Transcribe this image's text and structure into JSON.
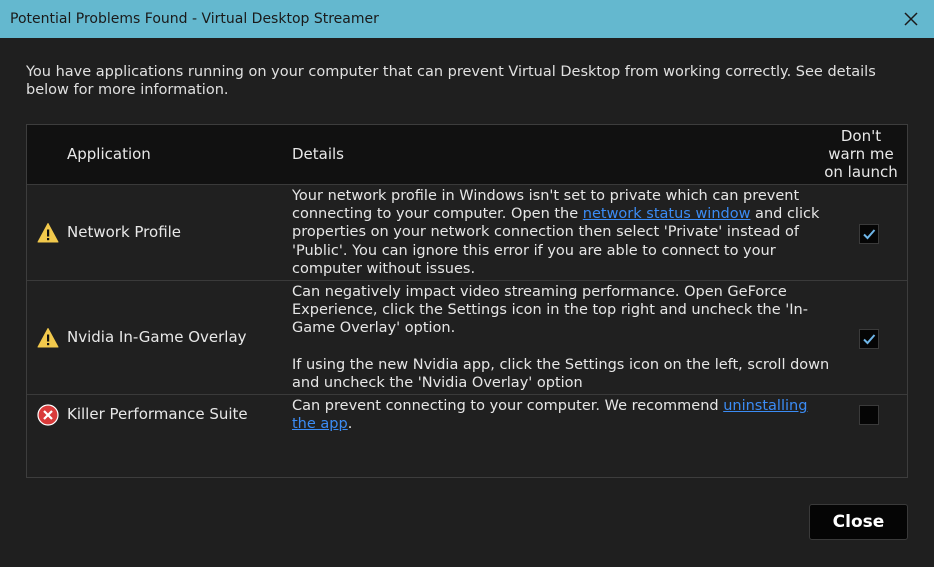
{
  "window": {
    "title": "Potential Problems Found - Virtual Desktop Streamer"
  },
  "intro": "You have applications running on your computer that can prevent Virtual Desktop from working correctly. See details below for more information.",
  "table": {
    "columns": [
      "Application",
      "Details",
      "Don't warn me on launch"
    ],
    "rows": [
      {
        "severity": "warning-icon",
        "application": "Network Profile",
        "details_pre": "Your network profile in Windows isn't set to private which can prevent connecting to your computer. Open the ",
        "details_link": "network status window",
        "details_post": " and click properties on your network connection then select 'Private' instead of 'Public'. You can ignore this error if you are able to connect to your computer without issues.",
        "dont_warn": true
      },
      {
        "severity": "warning-icon",
        "application": "Nvidia In-Game Overlay",
        "details_p1": "Can negatively impact video streaming performance. Open GeForce Experience, click the Settings icon in the top right and uncheck the 'In-Game Overlay' option.",
        "details_p2": "If using the new Nvidia app, click the Settings icon on the left, scroll down and uncheck the 'Nvidia Overlay' option",
        "dont_warn": true
      },
      {
        "severity": "error-icon",
        "application": "Killer Performance Suite",
        "details_pre": "Can prevent connecting to your computer. We recommend ",
        "details_link": "uninstalling the app",
        "details_post": ".",
        "dont_warn": false
      }
    ]
  },
  "buttons": {
    "close_label": "Close"
  },
  "colors": {
    "titlebar": "#64b8cf",
    "background": "#1f1f1f",
    "link": "#3b8cf5",
    "warning": "#f2c94c",
    "error": "#d93a3a",
    "check": "#6fb6e8"
  }
}
